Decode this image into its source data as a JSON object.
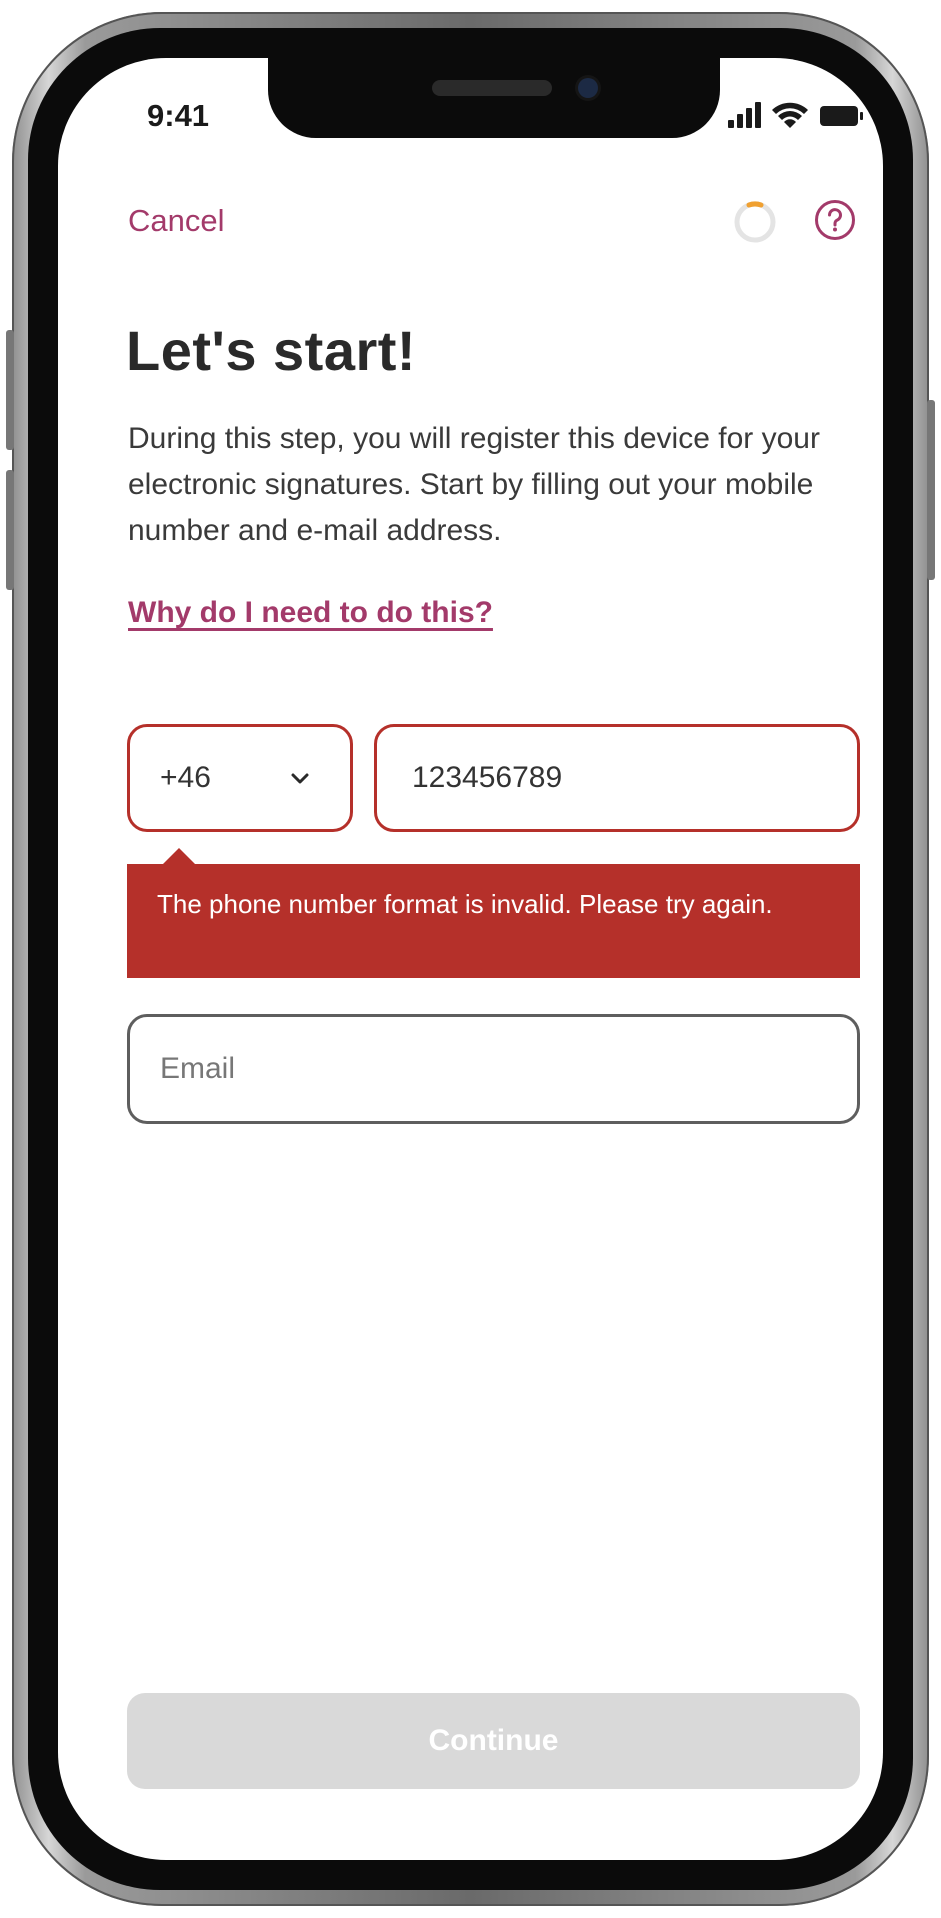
{
  "status_bar": {
    "time": "9:41"
  },
  "header": {
    "cancel_label": "Cancel"
  },
  "content": {
    "title": "Let's start!",
    "intro": "During this step, you will register this device for your electronic signatures. Start by filling out your mobile number and e-mail address.",
    "why_link": "Why do I need to do this?"
  },
  "form": {
    "country_code": "+46",
    "phone_value": "123456789",
    "phone_error": "The phone number format is invalid. Please try again.",
    "email_placeholder": "Email"
  },
  "footer": {
    "continue_label": "Continue"
  },
  "colors": {
    "accent": "#a33a6a",
    "error": "#b5302a",
    "disabled_button": "#d9d9d9",
    "spinner_progress": "#f0a030"
  },
  "icons": [
    "signal-icon",
    "wifi-icon",
    "battery-icon",
    "progress-spinner-icon",
    "help-icon",
    "chevron-down-icon"
  ]
}
